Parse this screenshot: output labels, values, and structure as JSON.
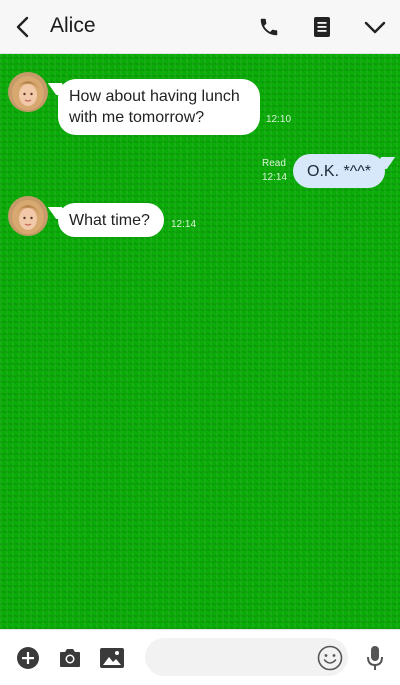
{
  "header": {
    "contact_name": "Alice",
    "icons": [
      "back-arrow-icon",
      "phone-icon",
      "notes-icon",
      "chevron-down-icon"
    ]
  },
  "messages": [
    {
      "direction": "incoming",
      "lines": [
        "How about having lunch",
        "with me tomorrow?"
      ],
      "time": "12:10"
    },
    {
      "direction": "outgoing",
      "text": "O.K. *^^*",
      "status": "Read",
      "time": "12:14"
    },
    {
      "direction": "incoming",
      "text": "What time?",
      "time": "12:14"
    }
  ],
  "input_bar": {
    "placeholder": "",
    "icons": [
      "add-icon",
      "camera-icon",
      "image-icon",
      "emoji-icon",
      "microphone-icon"
    ]
  },
  "colors": {
    "chat_background": "#0bad08",
    "incoming_bubble": "#ffffff",
    "outgoing_bubble": "#d8e8fb",
    "header_background": "#f7f7f7"
  }
}
